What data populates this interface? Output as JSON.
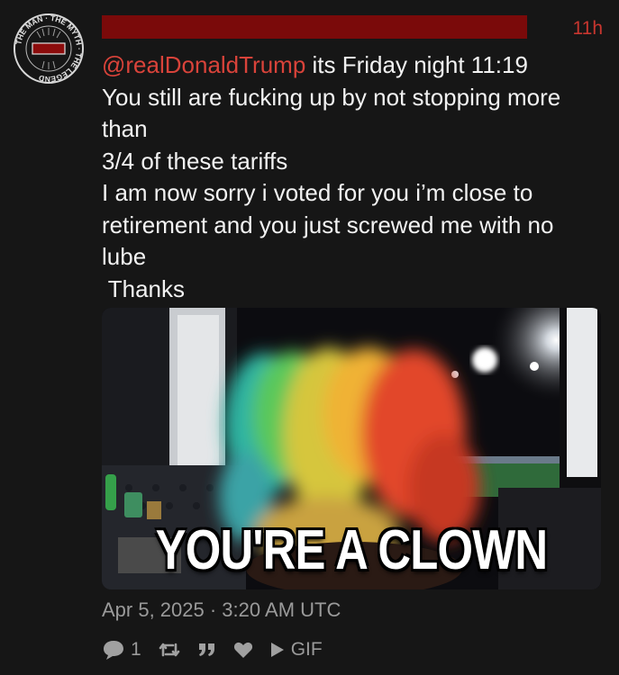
{
  "post": {
    "time_ago": "11h",
    "mention": "@realDonaldTrump",
    "first_line_rest": " its Friday night 11:19",
    "lines": [
      "You still are fucking up by not stopping more",
      "than",
      "3/4 of these tariffs",
      "I am now sorry i voted for you i’m close to",
      "retirement and you just screwed me with no",
      "lube",
      " Thanks"
    ],
    "gif_caption": "YOU'RE A CLOWN",
    "timestamp": "Apr 5, 2025 · 3:20 AM UTC"
  },
  "avatar": {
    "ring_text": "THE MAN · THE MYTH · THE LEGEND"
  },
  "actions": {
    "reply_count": "1",
    "gif_label": "GIF"
  },
  "colors": {
    "background": "#161616",
    "mention": "#d9433a",
    "time": "#c8362f",
    "redaction": "#7a0a0a",
    "muted": "#9a9a9a"
  }
}
